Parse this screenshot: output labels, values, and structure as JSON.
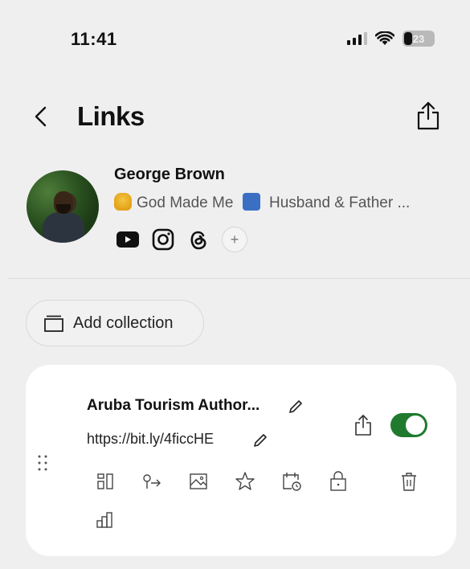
{
  "status": {
    "time": "11:41",
    "battery": "23"
  },
  "header": {
    "title": "Links",
    "back_icon": "chevron-left-icon",
    "share_icon": "share-icon"
  },
  "profile": {
    "name": "George Brown",
    "bio_text_1": "God Made Me",
    "bio_text_2": "Husband & Father ...",
    "socials": [
      "youtube-icon",
      "instagram-icon",
      "threads-icon"
    ],
    "add_social_label": "+"
  },
  "add_collection": {
    "label": "Add collection",
    "icon": "collection-icon"
  },
  "link_card": {
    "title": "Aruba Tourism Author...",
    "url": "https://bit.ly/4ficcHE",
    "enabled": true,
    "tools": [
      "layout-icon",
      "redirect-icon",
      "image-icon",
      "star-icon",
      "schedule-icon",
      "lock-icon",
      "trash-icon",
      "analytics-icon"
    ]
  },
  "colors": {
    "background": "#efefef",
    "toggle_on": "#1f7a2e",
    "card": "#ffffff"
  }
}
